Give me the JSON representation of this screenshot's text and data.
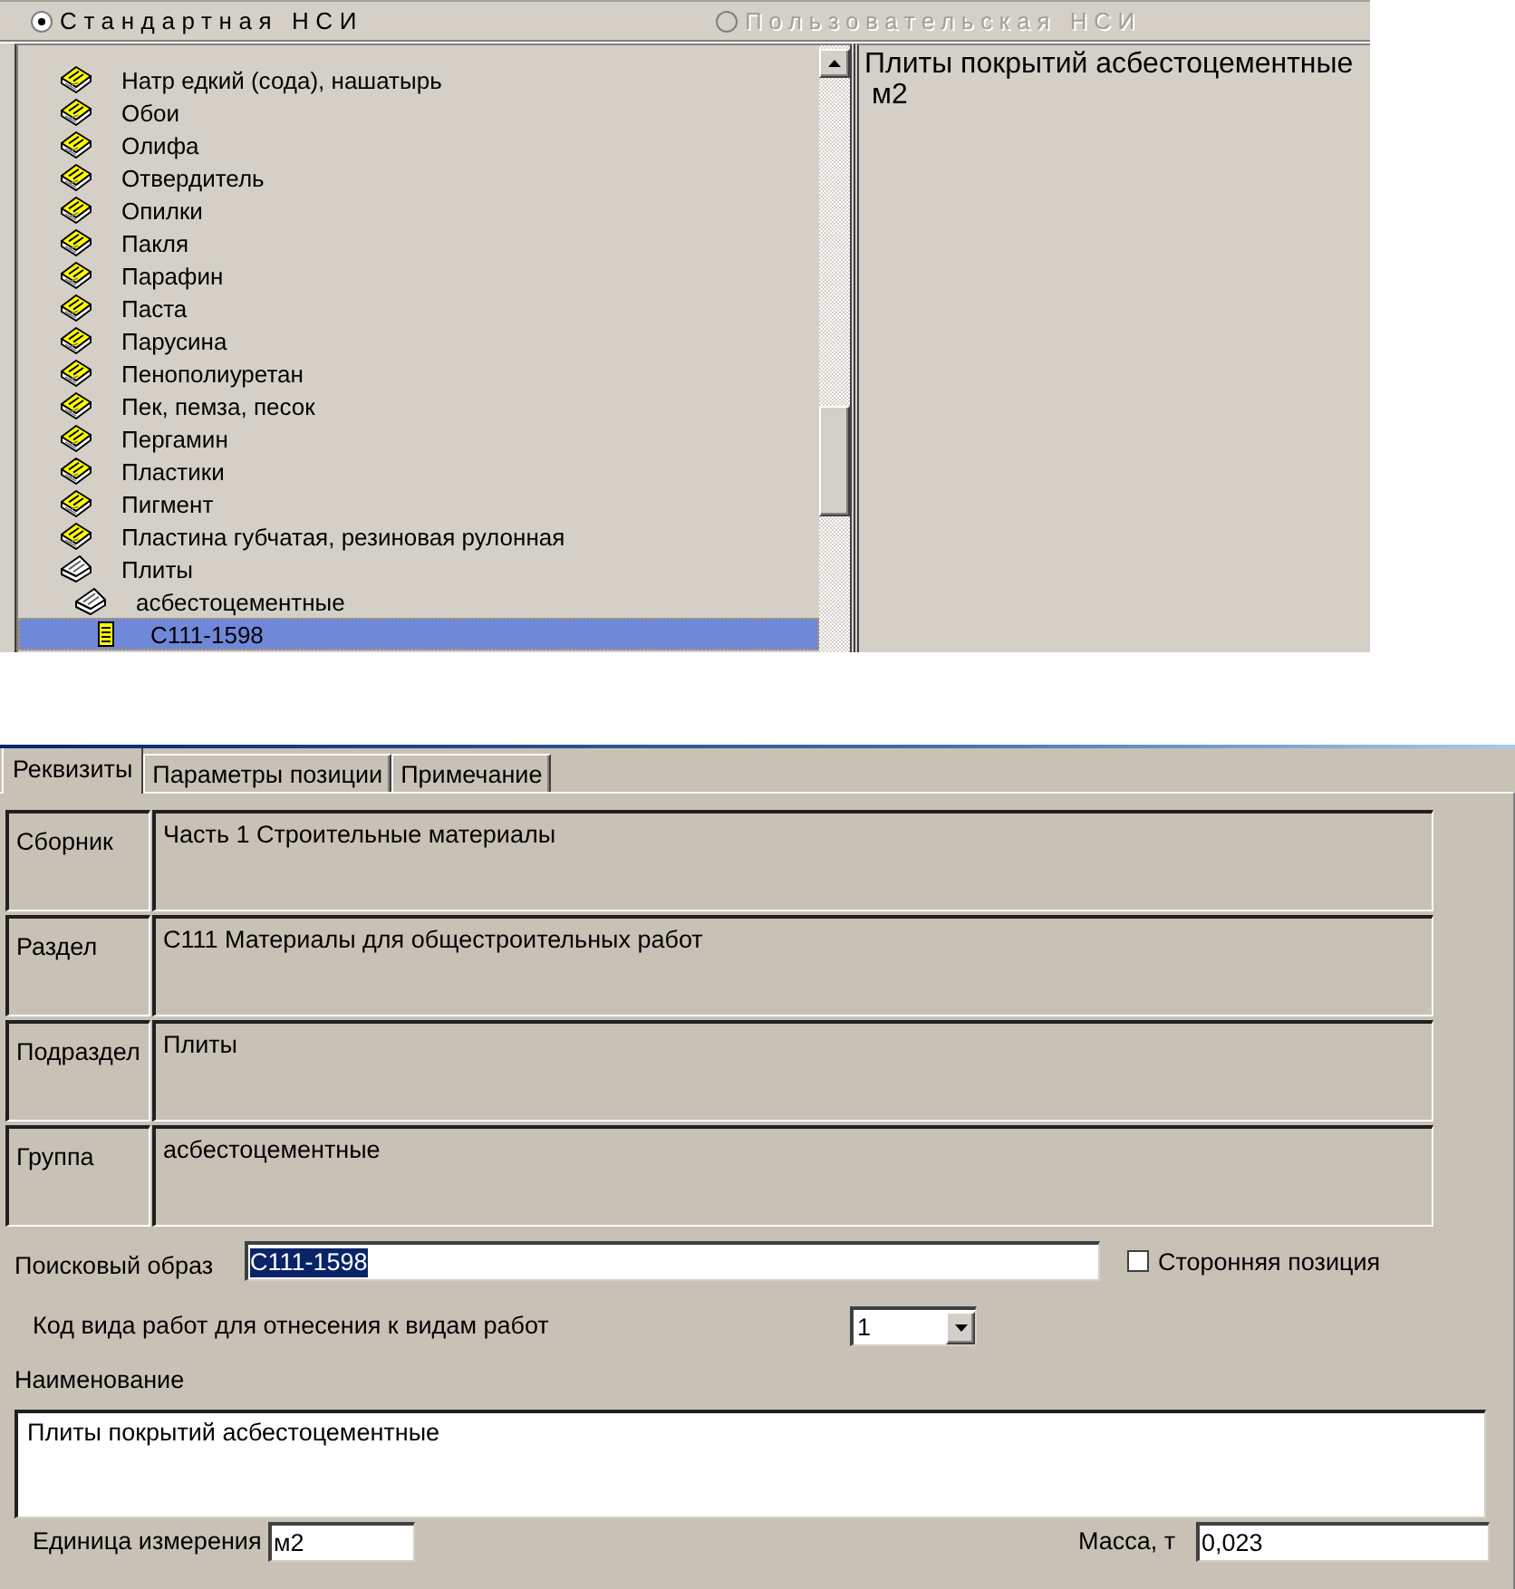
{
  "nsi_mode": [
    {
      "label": "Стандартная НСИ",
      "selected": true,
      "disabled": false
    },
    {
      "label": "Пользовательская НСИ",
      "selected": false,
      "disabled": true
    }
  ],
  "tree": {
    "items": [
      {
        "label": "Натр едкий (сода), нашатырь",
        "kind": "group",
        "expanded": false,
        "selected": false
      },
      {
        "label": "Обои",
        "kind": "group",
        "expanded": false,
        "selected": false
      },
      {
        "label": "Олифа",
        "kind": "group",
        "expanded": false,
        "selected": false
      },
      {
        "label": "Отвердитель",
        "kind": "group",
        "expanded": false,
        "selected": false
      },
      {
        "label": "Опилки",
        "kind": "group",
        "expanded": false,
        "selected": false
      },
      {
        "label": "Пакля",
        "kind": "group",
        "expanded": false,
        "selected": false
      },
      {
        "label": "Парафин",
        "kind": "group",
        "expanded": false,
        "selected": false
      },
      {
        "label": "Паста",
        "kind": "group",
        "expanded": false,
        "selected": false
      },
      {
        "label": "Парусина",
        "kind": "group",
        "expanded": false,
        "selected": false
      },
      {
        "label": "Пенополиуретан",
        "kind": "group",
        "expanded": false,
        "selected": false
      },
      {
        "label": "Пек, пемза, песок",
        "kind": "group",
        "expanded": false,
        "selected": false
      },
      {
        "label": "Пергамин",
        "kind": "group",
        "expanded": false,
        "selected": false
      },
      {
        "label": "Пластики",
        "kind": "group",
        "expanded": false,
        "selected": false
      },
      {
        "label": "Пигмент",
        "kind": "group",
        "expanded": false,
        "selected": false
      },
      {
        "label": "Пластина губчатая, резиновая рулонная",
        "kind": "group",
        "expanded": false,
        "selected": false
      },
      {
        "label": "Плиты",
        "kind": "group",
        "expanded": true,
        "selected": false,
        "children": [
          {
            "label": "асбестоцементные",
            "kind": "group",
            "expanded": true,
            "selected": false,
            "children": [
              {
                "label": "С111-1598",
                "kind": "item",
                "selected": true
              }
            ]
          }
        ]
      }
    ]
  },
  "preview": {
    "name": "Плиты покрытий асбестоцементные",
    "unit": "м2"
  },
  "form": {
    "tabs": [
      {
        "label": "Реквизиты",
        "selected": true
      },
      {
        "label": "Параметры позиции",
        "selected": false
      },
      {
        "label": "Примечание",
        "selected": false
      }
    ],
    "classification": [
      {
        "label": "Сборник",
        "value": "Часть 1 Строительные материалы"
      },
      {
        "label": "Раздел",
        "value": "С111 Материалы для общестроительных работ"
      },
      {
        "label": "Подраздел",
        "value": "Плиты"
      },
      {
        "label": "Группа",
        "value": "асбестоцементные"
      }
    ],
    "search_pattern": {
      "label": "Поисковый образ",
      "value": "С111-1598",
      "highlighted": true
    },
    "third_party": {
      "label": "Сторонняя позиция",
      "checked": false
    },
    "work_type_code": {
      "label": "Код вида работ для отнесения к видам работ",
      "value": "1"
    },
    "name": {
      "label": "Наименование",
      "value": "Плиты покрытий асбестоцементные"
    },
    "unit": {
      "label": "Единица измерения",
      "value": "м2"
    },
    "mass": {
      "label": "Масса, т",
      "value": "0,023"
    }
  }
}
